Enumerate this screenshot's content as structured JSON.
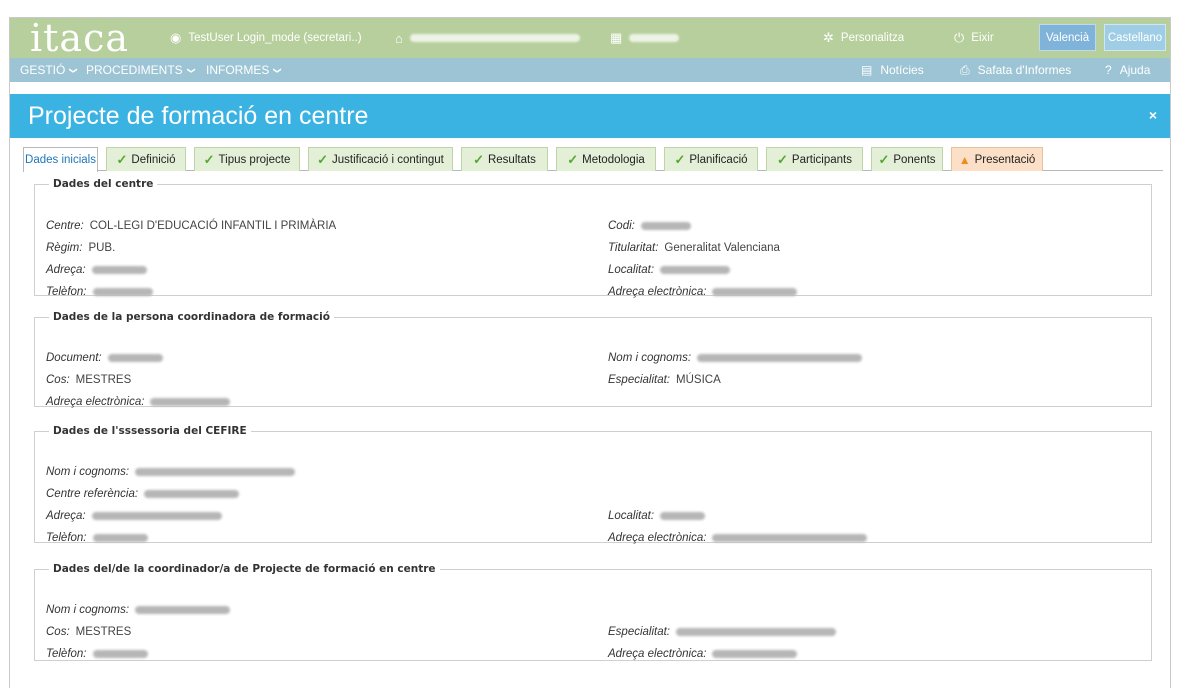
{
  "app": {
    "logo": "itaca"
  },
  "header": {
    "user": "TestUser Login_mode (secretari..)",
    "personalize": "Personalitza",
    "exit": "Eixir",
    "lang_valencia": "Valencià",
    "lang_castellano": "Castellano"
  },
  "menu": {
    "items": [
      "GESTIÓ",
      "PROCEDIMENTS",
      "INFORMES"
    ],
    "news": "Notícies",
    "reports": "Safata d'Informes",
    "help": "Ajuda"
  },
  "page": {
    "title": "Projecte de formació en centre",
    "close": "×"
  },
  "tabs": [
    {
      "label": "Dades inicials",
      "state": "active"
    },
    {
      "label": "Definició",
      "state": "done"
    },
    {
      "label": "Tipus projecte",
      "state": "done"
    },
    {
      "label": "Justificació i contingut",
      "state": "done"
    },
    {
      "label": "Resultats",
      "state": "done"
    },
    {
      "label": "Metodologia",
      "state": "done"
    },
    {
      "label": "Planificació",
      "state": "done"
    },
    {
      "label": "Participants",
      "state": "done"
    },
    {
      "label": "Ponents",
      "state": "done"
    },
    {
      "label": "Presentació",
      "state": "warning"
    }
  ],
  "sections": {
    "centre": {
      "title": "Dades del centre",
      "centre_label": "Centre:",
      "centre_value": "COL-LEGI D'EDUCACIÓ INFANTIL I PRIMÀRIA",
      "codi_label": "Codi:",
      "regim_label": "Règim:",
      "regim_value": "PUB.",
      "titularitat_label": "Titularitat:",
      "titularitat_value": "Generalitat Valenciana",
      "adreca_label": "Adreça:",
      "localitat_label": "Localitat:",
      "telefon_label": "Telèfon:",
      "email_label": "Adreça electrònica:"
    },
    "coordinadora": {
      "title": "Dades de la persona coordinadora de formació",
      "document_label": "Document:",
      "nom_label": "Nom i cognoms:",
      "cos_label": "Cos:",
      "cos_value": "MESTRES",
      "especialitat_label": "Especialitat:",
      "especialitat_value": "MÚSICA",
      "email_label": "Adreça electrònica:"
    },
    "assessoria": {
      "title": "Dades de l'sssessoria del CEFIRE",
      "nom_label": "Nom i cognoms:",
      "centre_ref_label": "Centre referència:",
      "adreca_label": "Adreça:",
      "localitat_label": "Localitat:",
      "telefon_label": "Telèfon:",
      "email_label": "Adreça electrònica:"
    },
    "coordinador_projecte": {
      "title": "Dades del/de la coordinador/a de Projecte de formació en centre",
      "nom_label": "Nom i cognoms:",
      "cos_label": "Cos:",
      "cos_value": "MESTRES",
      "especialitat_label": "Especialitat:",
      "telefon_label": "Telèfon:",
      "email_label": "Adreça electrònica:"
    }
  },
  "colors": {
    "header_green": "#b7cf9c",
    "menu_blue": "#9cc4d4",
    "title_blue": "#3ab3e2",
    "active_tab_text": "#1e77b8",
    "check_green": "#56a832",
    "warning_orange": "#ee8d1f"
  }
}
